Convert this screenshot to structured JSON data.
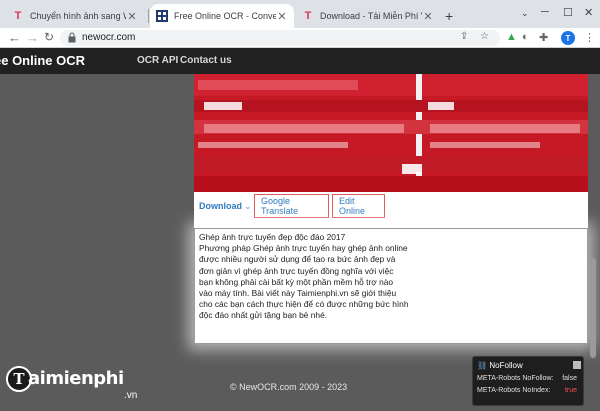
{
  "tabs": [
    {
      "title": "Chuyển hình ảnh sang Word, đổ",
      "favicon": "T",
      "favicon_color": "#d63b5a"
    },
    {
      "title": "Free Online OCR - Convert JPEG",
      "favicon": "grid",
      "favicon_color": "#1f3b73"
    },
    {
      "title": "Download - Tải Miễn Phí VN - Ph",
      "favicon": "T",
      "favicon_color": "#d63b5a"
    }
  ],
  "address": {
    "url": "newocr.com"
  },
  "site": {
    "brand": "ee Online OCR",
    "nav": [
      "OCR API",
      "Contact us"
    ]
  },
  "actions": {
    "download": "Download",
    "download_caret": "⌄",
    "google_translate": "Google Translate",
    "edit_online": "Edit Online"
  },
  "ocr_text": [
    "Ghép ảnh trực tuyến đẹp độc đáo 2017",
    "Phương pháp Ghép ảnh trực tuyến hay ghép ảnh online",
    "được nhiều người sử dụng để tạo ra bức ảnh đẹp và",
    "đơn giản vì ghép ảnh trực tuyến đồng nghĩa với việc",
    "bạn không phải cài bất kỳ một phần mềm hỗ trợ nào",
    "vào máy tính. Bài viết này Taimienphi.vn sẽ giới thiệu",
    "cho các bạn cách thực hiện để có được những bức hình",
    "độc đáo nhất gửi tặng bạn bè nhé."
  ],
  "footer": "© NewOCR.com 2009 - 2023",
  "watermark": {
    "name": "aimienphi",
    "initial": "T",
    "domain": ".vn"
  },
  "nofollow": {
    "title": "NoFollow",
    "rows": [
      {
        "label": "META-Robots NoFollow:",
        "value": "false",
        "color": "#e0e0e0"
      },
      {
        "label": "META-Robots NoIndex:",
        "value": "true",
        "color": "#ff4d4d"
      }
    ]
  },
  "colors": {
    "accent_red": "#c51a26",
    "link_blue": "#2f7bbf"
  }
}
